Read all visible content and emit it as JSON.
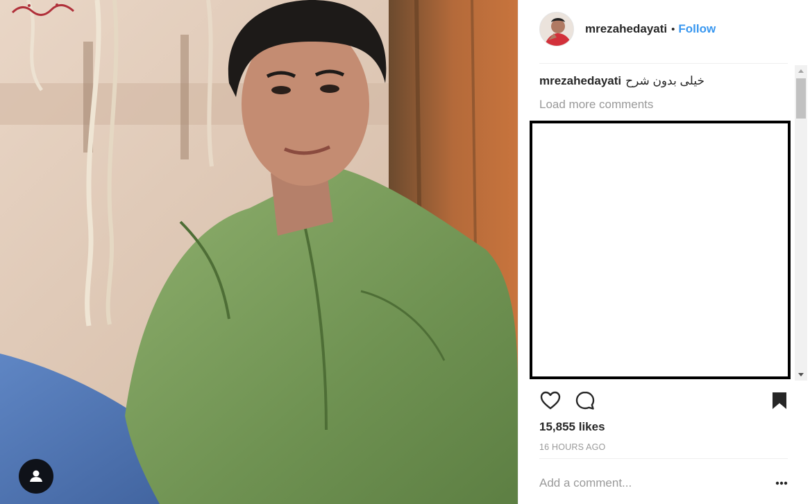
{
  "post": {
    "username": "mrezahedayati",
    "follow_separator": "•",
    "follow_label": "Follow",
    "caption_username": "mrezahedayati",
    "caption_text": "خیلی بدون شرح",
    "load_more_label": "Load more comments",
    "likes_label": "15,855 likes",
    "time_label": "16 HOURS AGO",
    "comment_placeholder": "Add a comment...",
    "photo_overlay_text": "بهروز وثوقی"
  },
  "icons": {
    "like": "heart-icon",
    "comment": "speech-bubble-icon",
    "save": "bookmark-icon",
    "tag": "user-tag-icon",
    "more": "more-options-icon"
  },
  "colors": {
    "accent": "#3897f0",
    "text": "#262626",
    "muted": "#999999",
    "divider": "#efefef"
  }
}
